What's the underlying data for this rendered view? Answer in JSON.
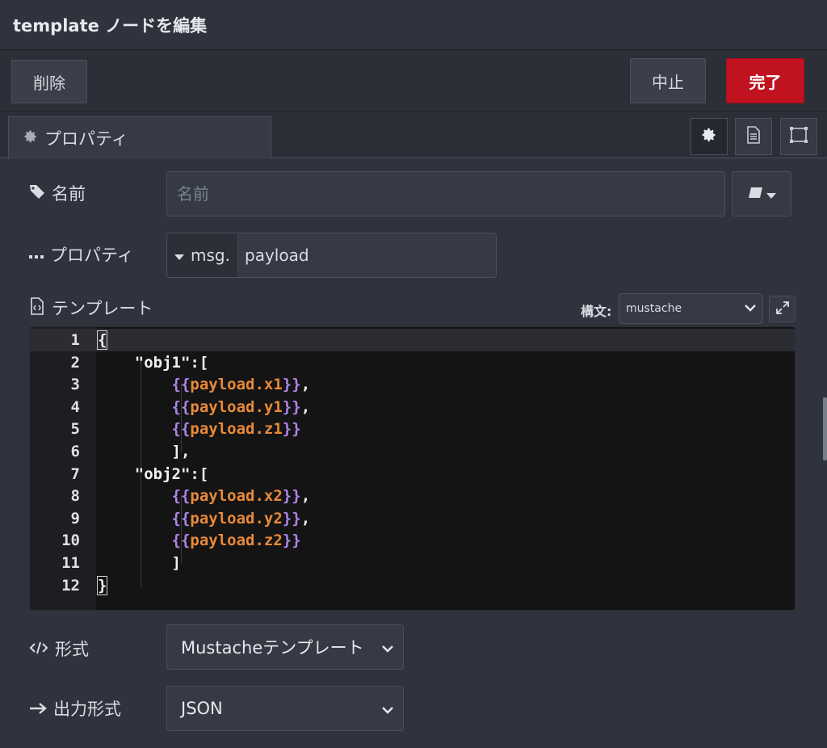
{
  "header": {
    "title": "template ノードを編集"
  },
  "toolbar": {
    "delete_label": "削除",
    "cancel_label": "中止",
    "done_label": "完了"
  },
  "tabs": {
    "properties_label": "プロパティ"
  },
  "form": {
    "name": {
      "label": "名前",
      "placeholder": "名前"
    },
    "property": {
      "label": "プロパティ",
      "type": "msg.",
      "value": "payload"
    },
    "template": {
      "label": "テンプレート",
      "syntax_label": "構文:",
      "syntax_value": "mustache"
    },
    "format": {
      "label": "形式",
      "value": "Mustacheテンプレート"
    },
    "output": {
      "label": "出力形式",
      "value": "JSON"
    }
  },
  "editor": {
    "line_numbers": [
      "1",
      "2",
      "3",
      "4",
      "5",
      "6",
      "7",
      "8",
      "9",
      "10",
      "11",
      "12"
    ],
    "lines": [
      "{",
      "    \"obj1\":[",
      "        {{payload.x1}},",
      "        {{payload.y1}},",
      "        {{payload.z1}}",
      "        ],",
      "    \"obj2\":[",
      "        {{payload.x2}},",
      "        {{payload.y2}},",
      "        {{payload.z2}}",
      "        ]",
      "}"
    ]
  },
  "colors": {
    "background": "#2f333d",
    "done_button": "#c0121f",
    "editor_bg": "#141414",
    "mustache_brace": "#b084e8",
    "mustache_var": "#e8893a"
  }
}
